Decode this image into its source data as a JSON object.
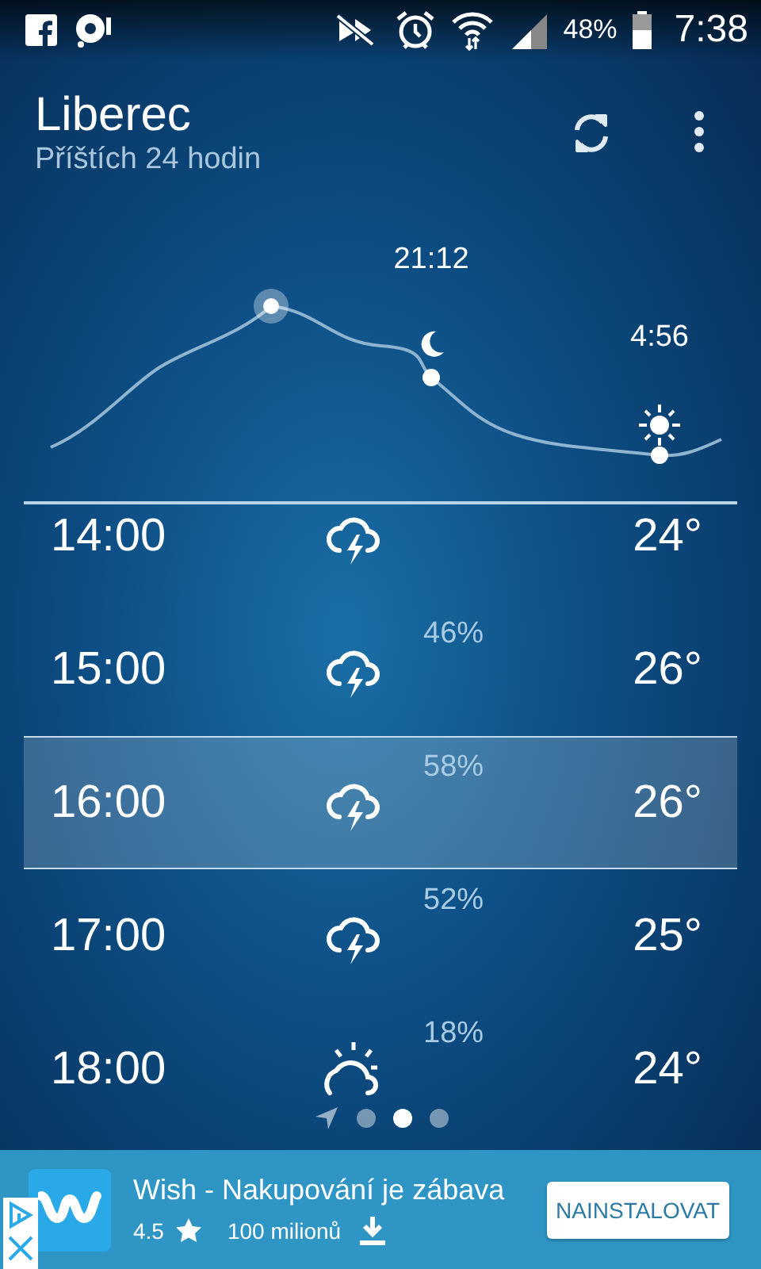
{
  "status_bar": {
    "battery": "48%",
    "time": "7:38"
  },
  "header": {
    "city": "Liberec",
    "subtitle": "Příštích 24 hodin"
  },
  "chart": {
    "events": [
      {
        "time": "21:12",
        "kind": "moon"
      },
      {
        "time": "4:56",
        "kind": "sun"
      }
    ]
  },
  "hours": [
    {
      "time": "14:00",
      "kind": "storm",
      "temp": "24°",
      "selected": false
    },
    {
      "time": "15:00",
      "kind": "storm",
      "precip": "46%",
      "temp": "26°",
      "selected": false
    },
    {
      "time": "16:00",
      "kind": "storm",
      "precip": "58%",
      "temp": "26°",
      "selected": true
    },
    {
      "time": "17:00",
      "kind": "storm",
      "precip": "52%",
      "temp": "25°",
      "selected": false
    },
    {
      "time": "18:00",
      "kind": "partly-sunny",
      "precip": "18%",
      "temp": "24°",
      "selected": false
    }
  ],
  "pages": [
    {
      "kind": "location",
      "selected": false
    },
    {
      "kind": "dot",
      "selected": false
    },
    {
      "kind": "dot",
      "selected": true
    },
    {
      "kind": "dot",
      "selected": false
    }
  ],
  "ad": {
    "title": "Wish - Nakupování je zábava",
    "rating": "4.5",
    "installs": "100 milionů",
    "button": "NAINSTALOVAT"
  }
}
